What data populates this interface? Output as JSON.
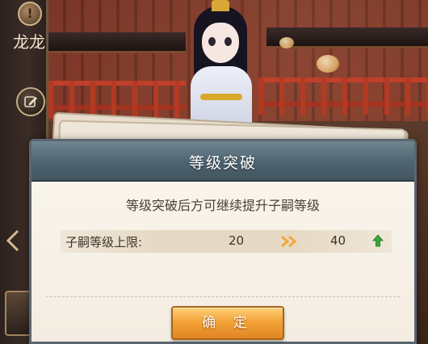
{
  "sidebar": {
    "warning_glyph": "!",
    "character_name": "龙龙",
    "edit_icon": "pencil-icon"
  },
  "dialog": {
    "title": "等级突破",
    "description": "等级突破后方可继续提升子嗣等级",
    "stat": {
      "label": "子嗣等级上限:",
      "old_value": "20",
      "new_value": "40",
      "arrow_icon": "double-chevron-right-icon",
      "up_icon": "green-up-arrow-icon"
    },
    "confirm_label": "确 定"
  },
  "colors": {
    "header": "#4e6470",
    "button": "#f3a439",
    "arrow": "#f2a63a",
    "up_arrow": "#3aa83a",
    "panel": "#f7f1e7"
  }
}
